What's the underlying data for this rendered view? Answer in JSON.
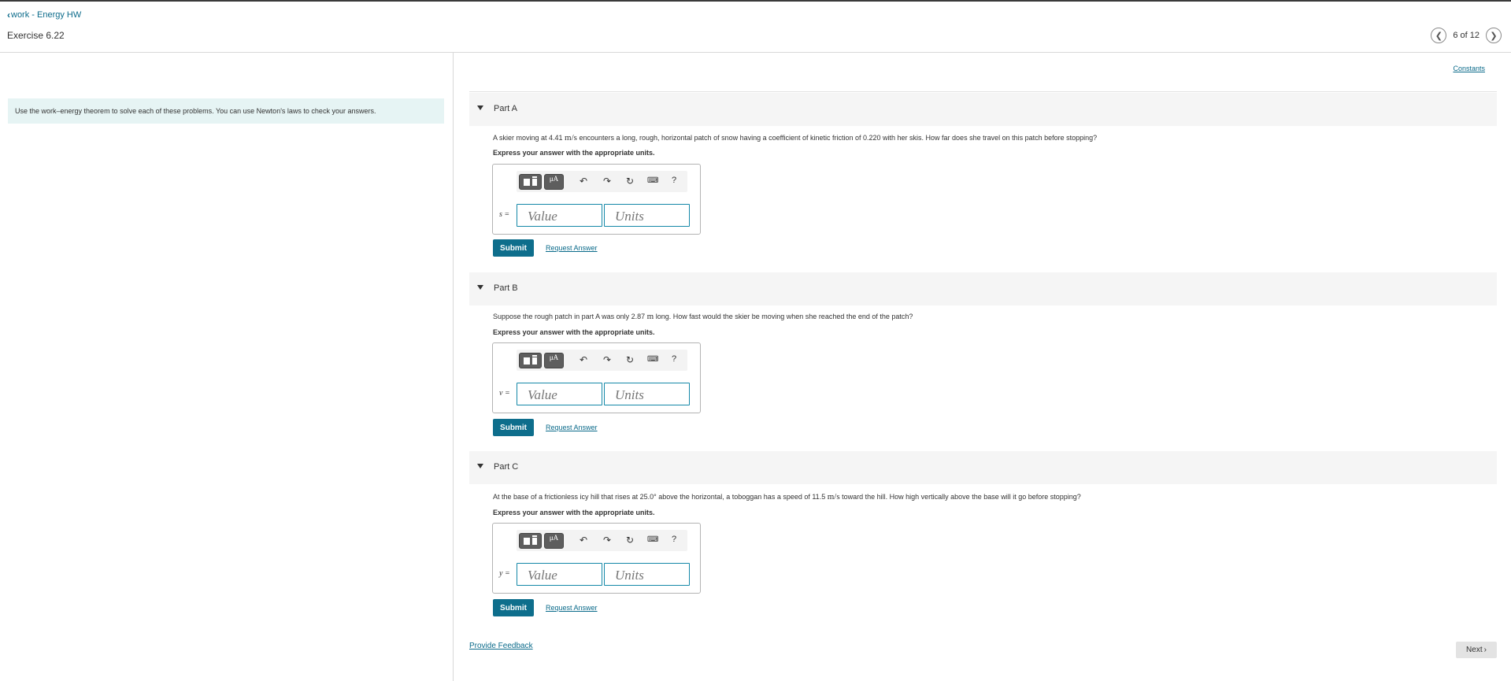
{
  "header": {
    "back_label": "work - Energy HW",
    "exercise_title": "Exercise 6.22",
    "pager_text": "6 of 12"
  },
  "intro": "Use the work–energy theorem to solve each of these problems. You can use Newton's laws to check your answers.",
  "constants_label": "Constants",
  "parts": [
    {
      "label": "Part A",
      "question_pre": "A skier moving at 4.41 ",
      "question_unit": "m/s",
      "question_post": " encounters a long, rough, horizontal patch of snow having a coefficient of kinetic friction of 0.220 with her skis. How far does she travel on this patch before stopping?",
      "instruction": "Express your answer with the appropriate units.",
      "variable": "s =",
      "value_placeholder": "Value",
      "units_placeholder": "Units",
      "submit_label": "Submit",
      "request_label": "Request Answer"
    },
    {
      "label": "Part B",
      "question_pre": "Suppose the rough patch in part A was only 2.87 ",
      "question_unit": "m",
      "question_post": " long. How fast would the skier be moving when she reached the end of the patch?",
      "instruction": "Express your answer with the appropriate units.",
      "variable": "v =",
      "value_placeholder": "Value",
      "units_placeholder": "Units",
      "submit_label": "Submit",
      "request_label": "Request Answer"
    },
    {
      "label": "Part C",
      "question_pre": "At the base of a frictionless icy hill that rises at 25.0° above the horizontal, a toboggan has a speed of 11.5 ",
      "question_unit": "m/s",
      "question_post": " toward the hill. How high vertically above the base will it go before stopping?",
      "instruction": "Express your answer with the appropriate units.",
      "variable": "y =",
      "value_placeholder": "Value",
      "units_placeholder": "Units",
      "submit_label": "Submit",
      "request_label": "Request Answer"
    }
  ],
  "toolbar": {
    "mu_label": "μA",
    "help_label": "?"
  },
  "footer": {
    "feedback_label": "Provide Feedback",
    "next_label": "Next"
  },
  "icons": {
    "back": "chevron-left-icon",
    "prev": "chevron-left-icon",
    "next": "chevron-right-icon",
    "undo": "undo-icon",
    "redo": "redo-icon",
    "reset": "reset-icon",
    "keyboard": "keyboard-icon"
  },
  "colors": {
    "link": "#0a6a8a",
    "submit": "#0e6e8c",
    "intro_bg": "#e6f4f4",
    "field_border": "#1488a8"
  }
}
